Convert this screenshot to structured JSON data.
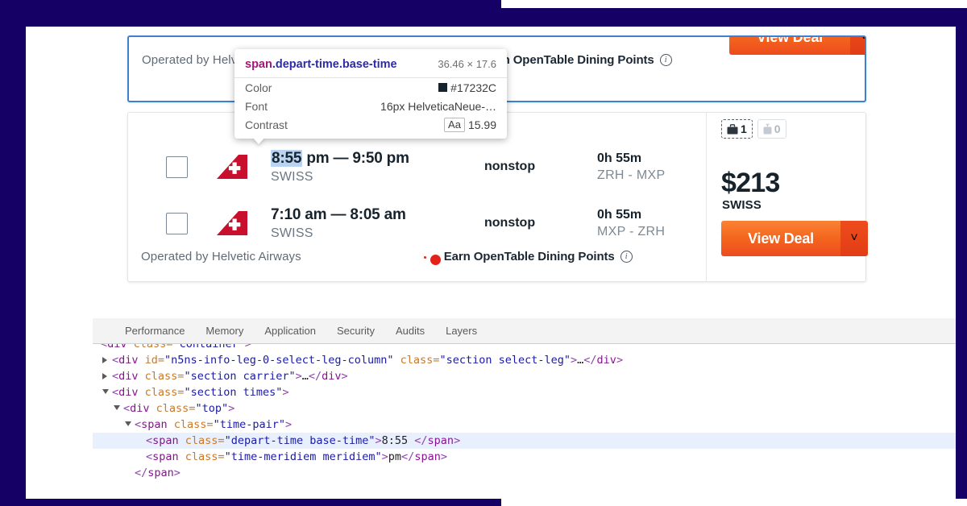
{
  "theme": {
    "frame_color": "#150066",
    "accent_orange": "#F4681F",
    "selection_blue": "#B9D3F0",
    "card_focus_border": "#3F7FD0"
  },
  "results": {
    "top_card": {
      "operated_by": "Operated by Helvetic Airways",
      "dining_label": "Earn OpenTable Dining Points",
      "info_glyph": "i",
      "deal_label": "View Deal",
      "deal_arrow": "˅"
    },
    "main_card": {
      "flights": [
        {
          "time_highlighted": "8:55",
          "time_rest": " pm — 9:50 pm",
          "carrier": "SWISS",
          "stops": "nonstop",
          "duration": "0h 55m",
          "route": "ZRH - MXP"
        },
        {
          "time_highlighted": "",
          "time_rest": "7:10 am — 8:05 am",
          "carrier": "SWISS",
          "stops": "nonstop",
          "duration": "0h 55m",
          "route": "MXP - ZRH"
        }
      ],
      "operated_by": "Operated by Helvetic Airways",
      "dining_label": "Earn OpenTable Dining Points",
      "info_glyph": "i",
      "bags": {
        "checked_count": "1",
        "carryon_count": "0"
      },
      "price": "$213",
      "price_carrier": "SWISS",
      "deal_label": "View Deal",
      "deal_arrow": "˅"
    }
  },
  "devtools": {
    "tabs": [
      {
        "label": "Performance"
      },
      {
        "label": "Memory"
      },
      {
        "label": "Application"
      },
      {
        "label": "Security"
      },
      {
        "label": "Audits"
      },
      {
        "label": "Layers"
      }
    ],
    "dom_lines": [
      {
        "indent": 0,
        "triangle": "none",
        "selected": false,
        "parts": [
          {
            "cls": "t-punc",
            "text": "<"
          },
          {
            "cls": "t-tag",
            "text": "div"
          },
          {
            "cls": "t-attr",
            "text": " class="
          },
          {
            "cls": "t-val",
            "text": "\"container\""
          },
          {
            "cls": "t-punc",
            "text": ">"
          }
        ]
      },
      {
        "indent": 1,
        "triangle": "closed",
        "selected": false,
        "parts": [
          {
            "cls": "t-punc",
            "text": "<"
          },
          {
            "cls": "t-tag",
            "text": "div"
          },
          {
            "cls": "t-attr",
            "text": " id="
          },
          {
            "cls": "t-val",
            "text": "\"n5ns-info-leg-0-select-leg-column\""
          },
          {
            "cls": "t-attr",
            "text": " class="
          },
          {
            "cls": "t-val",
            "text": "\"section select-leg\""
          },
          {
            "cls": "t-punc",
            "text": ">"
          },
          {
            "cls": "t-text",
            "text": "…"
          },
          {
            "cls": "t-punc",
            "text": "</"
          },
          {
            "cls": "t-tag",
            "text": "div"
          },
          {
            "cls": "t-punc",
            "text": ">"
          }
        ]
      },
      {
        "indent": 1,
        "triangle": "closed",
        "selected": false,
        "parts": [
          {
            "cls": "t-punc",
            "text": "<"
          },
          {
            "cls": "t-tag",
            "text": "div"
          },
          {
            "cls": "t-attr",
            "text": " class="
          },
          {
            "cls": "t-val",
            "text": "\"section carrier\""
          },
          {
            "cls": "t-punc",
            "text": ">"
          },
          {
            "cls": "t-text",
            "text": "…"
          },
          {
            "cls": "t-punc",
            "text": "</"
          },
          {
            "cls": "t-tag",
            "text": "div"
          },
          {
            "cls": "t-punc",
            "text": ">"
          }
        ]
      },
      {
        "indent": 1,
        "triangle": "open",
        "selected": false,
        "parts": [
          {
            "cls": "t-punc",
            "text": "<"
          },
          {
            "cls": "t-tag",
            "text": "div"
          },
          {
            "cls": "t-attr",
            "text": " class="
          },
          {
            "cls": "t-val",
            "text": "\"section times\""
          },
          {
            "cls": "t-punc",
            "text": ">"
          }
        ]
      },
      {
        "indent": 2,
        "triangle": "open",
        "selected": false,
        "parts": [
          {
            "cls": "t-punc",
            "text": "<"
          },
          {
            "cls": "t-tag",
            "text": "div"
          },
          {
            "cls": "t-attr",
            "text": " class="
          },
          {
            "cls": "t-val",
            "text": "\"top\""
          },
          {
            "cls": "t-punc",
            "text": ">"
          }
        ]
      },
      {
        "indent": 3,
        "triangle": "open",
        "selected": false,
        "parts": [
          {
            "cls": "t-punc",
            "text": "<"
          },
          {
            "cls": "t-tag",
            "text": "span"
          },
          {
            "cls": "t-attr",
            "text": " class="
          },
          {
            "cls": "t-val",
            "text": "\"time-pair\""
          },
          {
            "cls": "t-punc",
            "text": ">"
          }
        ]
      },
      {
        "indent": 4,
        "triangle": "none",
        "selected": true,
        "parts": [
          {
            "cls": "t-punc",
            "text": "<"
          },
          {
            "cls": "t-tag",
            "text": "span"
          },
          {
            "cls": "t-attr",
            "text": " class="
          },
          {
            "cls": "t-val",
            "text": "\"depart-time base-time\""
          },
          {
            "cls": "t-punc",
            "text": ">"
          },
          {
            "cls": "t-text",
            "text": "8:55 "
          },
          {
            "cls": "t-punc",
            "text": "</"
          },
          {
            "cls": "t-tag",
            "text": "span"
          },
          {
            "cls": "t-punc",
            "text": ">"
          }
        ]
      },
      {
        "indent": 4,
        "triangle": "none",
        "selected": false,
        "parts": [
          {
            "cls": "t-punc",
            "text": "<"
          },
          {
            "cls": "t-tag",
            "text": "span"
          },
          {
            "cls": "t-attr",
            "text": " class="
          },
          {
            "cls": "t-val",
            "text": "\"time-meridiem meridiem\""
          },
          {
            "cls": "t-punc",
            "text": ">"
          },
          {
            "cls": "t-text",
            "text": "pm"
          },
          {
            "cls": "t-punc",
            "text": "</"
          },
          {
            "cls": "t-tag",
            "text": "span"
          },
          {
            "cls": "t-punc",
            "text": ">"
          }
        ]
      },
      {
        "indent": 3,
        "triangle": "none",
        "selected": false,
        "parts": [
          {
            "cls": "t-punc",
            "text": "</"
          },
          {
            "cls": "t-tag",
            "text": "span"
          },
          {
            "cls": "t-punc",
            "text": ">"
          }
        ]
      }
    ]
  },
  "inspect_tooltip": {
    "selector_tag": "span",
    "selector_classes": ".depart-time.base-time",
    "dimensions": "36.46 × 17.6",
    "rows": [
      {
        "key": "Color",
        "value": "#17232C",
        "swatch": "#17232C",
        "badge": ""
      },
      {
        "key": "Font",
        "value": "16px HelveticaNeue-…",
        "swatch": "",
        "badge": ""
      },
      {
        "key": "Contrast",
        "value": "15.99",
        "swatch": "",
        "badge": "Aa"
      }
    ]
  }
}
